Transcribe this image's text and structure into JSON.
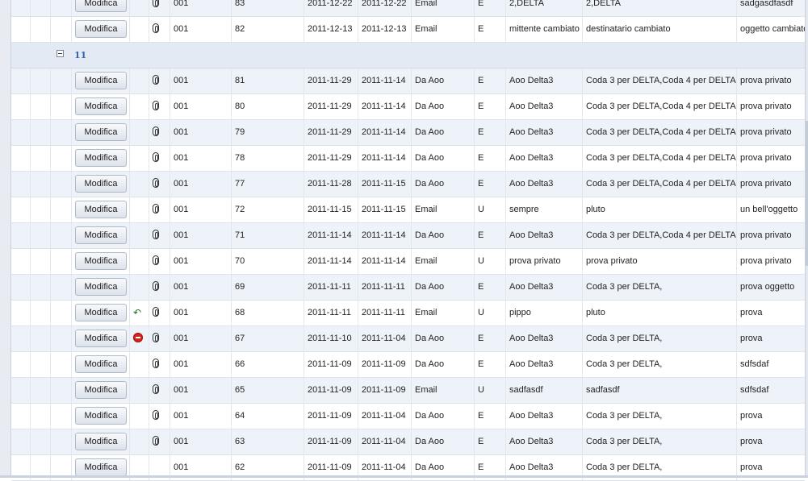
{
  "button_label": "Modifica",
  "group": {
    "label": "11"
  },
  "rows_before": [
    {
      "aoo": "001",
      "num": "83",
      "date1": "2011-12-22",
      "date2": "2011-12-22",
      "mezzo": "Email",
      "dir": "E",
      "mittente": "2,DELTA",
      "destinatario": "2,DELTA",
      "oggetto": "sadgasdfasdf",
      "status_icon": "",
      "attachment": true
    },
    {
      "aoo": "001",
      "num": "82",
      "date1": "2011-12-13",
      "date2": "2011-12-13",
      "mezzo": "Email",
      "dir": "E",
      "mittente": "mittente cambiato",
      "destinatario": "destinatario cambiato",
      "oggetto": "oggetto cambiato",
      "status_icon": "",
      "attachment": true
    }
  ],
  "rows": [
    {
      "aoo": "001",
      "num": "81",
      "date1": "2011-11-29",
      "date2": "2011-11-14",
      "mezzo": "Da Aoo",
      "dir": "E",
      "mittente": "Aoo Delta3",
      "destinatario": "Coda 3 per DELTA,Coda 4 per DELTA,",
      "oggetto": "prova privato",
      "status_icon": "",
      "attachment": true
    },
    {
      "aoo": "001",
      "num": "80",
      "date1": "2011-11-29",
      "date2": "2011-11-14",
      "mezzo": "Da Aoo",
      "dir": "E",
      "mittente": "Aoo Delta3",
      "destinatario": "Coda 3 per DELTA,Coda 4 per DELTA,",
      "oggetto": "prova privato",
      "status_icon": "",
      "attachment": true
    },
    {
      "aoo": "001",
      "num": "79",
      "date1": "2011-11-29",
      "date2": "2011-11-14",
      "mezzo": "Da Aoo",
      "dir": "E",
      "mittente": "Aoo Delta3",
      "destinatario": "Coda 3 per DELTA,Coda 4 per DELTA,",
      "oggetto": "prova privato",
      "status_icon": "",
      "attachment": true
    },
    {
      "aoo": "001",
      "num": "78",
      "date1": "2011-11-29",
      "date2": "2011-11-14",
      "mezzo": "Da Aoo",
      "dir": "E",
      "mittente": "Aoo Delta3",
      "destinatario": "Coda 3 per DELTA,Coda 4 per DELTA,",
      "oggetto": "prova privato",
      "status_icon": "",
      "attachment": true
    },
    {
      "aoo": "001",
      "num": "77",
      "date1": "2011-11-28",
      "date2": "2011-11-15",
      "mezzo": "Da Aoo",
      "dir": "E",
      "mittente": "Aoo Delta3",
      "destinatario": "Coda 3 per DELTA,Coda 4 per DELTA,",
      "oggetto": "prova privato",
      "status_icon": "",
      "attachment": true
    },
    {
      "aoo": "001",
      "num": "72",
      "date1": "2011-11-15",
      "date2": "2011-11-15",
      "mezzo": "Email",
      "dir": "U",
      "mittente": "sempre",
      "destinatario": "pluto",
      "oggetto": "un bell'oggetto",
      "status_icon": "",
      "attachment": true
    },
    {
      "aoo": "001",
      "num": "71",
      "date1": "2011-11-14",
      "date2": "2011-11-14",
      "mezzo": "Da Aoo",
      "dir": "E",
      "mittente": "Aoo Delta3",
      "destinatario": "Coda 3 per DELTA,Coda 4 per DELTA,",
      "oggetto": "prova privato",
      "status_icon": "",
      "attachment": true
    },
    {
      "aoo": "001",
      "num": "70",
      "date1": "2011-11-14",
      "date2": "2011-11-14",
      "mezzo": "Email",
      "dir": "U",
      "mittente": "prova privato",
      "destinatario": "prova privato",
      "oggetto": "prova privato",
      "status_icon": "",
      "attachment": true
    },
    {
      "aoo": "001",
      "num": "69",
      "date1": "2011-11-11",
      "date2": "2011-11-11",
      "mezzo": "Da Aoo",
      "dir": "E",
      "mittente": "Aoo Delta3",
      "destinatario": "Coda 3 per DELTA,",
      "oggetto": "prova oggetto",
      "status_icon": "",
      "attachment": true
    },
    {
      "aoo": "001",
      "num": "68",
      "date1": "2011-11-11",
      "date2": "2011-11-11",
      "mezzo": "Email",
      "dir": "U",
      "mittente": "pippo",
      "destinatario": "pluto",
      "oggetto": "prova",
      "status_icon": "reply-icon",
      "attachment": true
    },
    {
      "aoo": "001",
      "num": "67",
      "date1": "2011-11-10",
      "date2": "2011-11-04",
      "mezzo": "Da Aoo",
      "dir": "E",
      "mittente": "Aoo Delta3",
      "destinatario": "Coda 3 per DELTA,",
      "oggetto": "prova",
      "status_icon": "stop-icon",
      "attachment": true
    },
    {
      "aoo": "001",
      "num": "66",
      "date1": "2011-11-09",
      "date2": "2011-11-09",
      "mezzo": "Da Aoo",
      "dir": "E",
      "mittente": "Aoo Delta3",
      "destinatario": "Coda 3 per DELTA,",
      "oggetto": "sdfsdaf",
      "status_icon": "",
      "attachment": true
    },
    {
      "aoo": "001",
      "num": "65",
      "date1": "2011-11-09",
      "date2": "2011-11-09",
      "mezzo": "Email",
      "dir": "U",
      "mittente": "sadfasdf",
      "destinatario": "sadfasdf",
      "oggetto": "sdfsdaf",
      "status_icon": "",
      "attachment": true
    },
    {
      "aoo": "001",
      "num": "64",
      "date1": "2011-11-09",
      "date2": "2011-11-04",
      "mezzo": "Da Aoo",
      "dir": "E",
      "mittente": "Aoo Delta3",
      "destinatario": "Coda 3 per DELTA,",
      "oggetto": "prova",
      "status_icon": "",
      "attachment": true
    },
    {
      "aoo": "001",
      "num": "63",
      "date1": "2011-11-09",
      "date2": "2011-11-04",
      "mezzo": "Da Aoo",
      "dir": "E",
      "mittente": "Aoo Delta3",
      "destinatario": "Coda 3 per DELTA,",
      "oggetto": "prova",
      "status_icon": "",
      "attachment": true
    },
    {
      "aoo": "001",
      "num": "62",
      "date1": "2011-11-09",
      "date2": "2011-11-04",
      "mezzo": "Da Aoo",
      "dir": "E",
      "mittente": "Aoo Delta3",
      "destinatario": "Coda 3 per DELTA,",
      "oggetto": "prova",
      "status_icon": "",
      "attachment": false
    }
  ]
}
